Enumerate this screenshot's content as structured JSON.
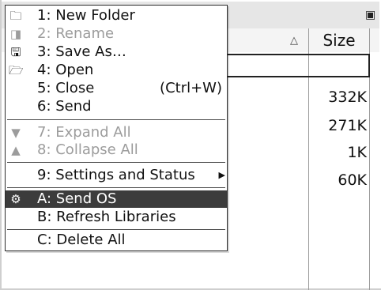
{
  "browser": {
    "size_header": "Size",
    "sizes": [
      "332K",
      "271K",
      "1K",
      "60K"
    ]
  },
  "menu": {
    "items": [
      {
        "label": "1: New Folder",
        "icon": "new-folder-icon",
        "glyph": "🗀"
      },
      {
        "label": "2: Rename",
        "icon": "rename-icon",
        "glyph": "◨"
      },
      {
        "label": "3: Save As…",
        "icon": "save-as-icon",
        "glyph": "🖫"
      },
      {
        "label": "4: Open",
        "icon": "open-icon",
        "glyph": "🗁"
      },
      {
        "label": "5: Close",
        "shortcut": "(Ctrl+W)"
      },
      {
        "label": "6: Send"
      },
      {
        "label": "7: Expand All",
        "icon": "expand-all-icon",
        "glyph": "▼"
      },
      {
        "label": "8: Collapse All",
        "icon": "collapse-all-icon",
        "glyph": "▲"
      },
      {
        "label": "9: Settings and Status"
      },
      {
        "label": "A: Send OS",
        "icon": "send-os-icon",
        "glyph": "⚙"
      },
      {
        "label": "B: Refresh Libraries"
      },
      {
        "label": "C: Delete All"
      }
    ]
  }
}
